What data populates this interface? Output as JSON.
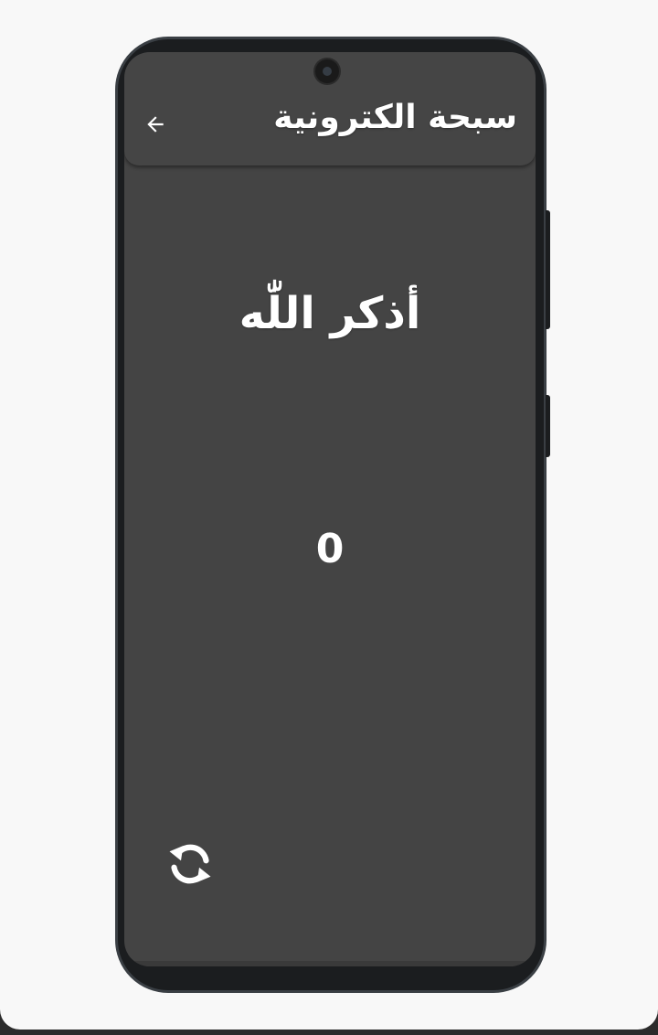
{
  "appbar": {
    "title": "سبحة الكترونية",
    "back_icon": "arrow-left-icon"
  },
  "main": {
    "dhikr_text": "أذكر اللّٰه",
    "counter_value": "0",
    "reset_icon": "refresh-icon"
  },
  "colors": {
    "screen_background": "#444444",
    "appbar_background": "#454545",
    "text": "#ffffff",
    "page_background": "#f8f8f8"
  }
}
